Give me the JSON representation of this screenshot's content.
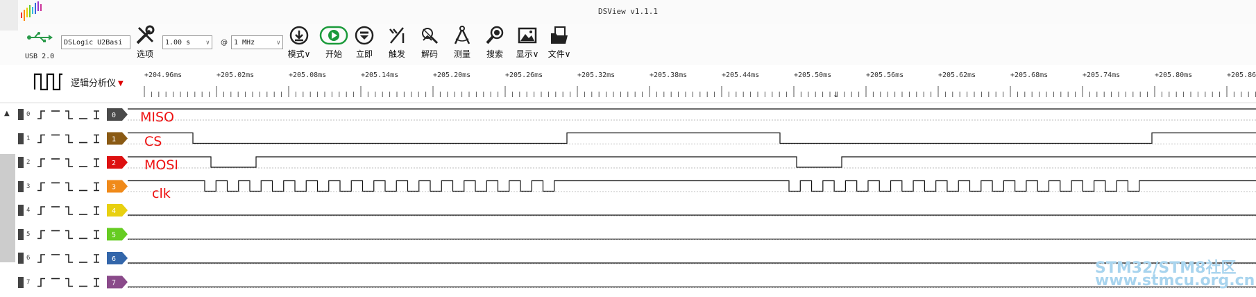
{
  "app": {
    "title": "DSView v1.1.1"
  },
  "device": {
    "usb_label": "USB 2.0",
    "name": "DSLogic U2Basi",
    "duration": "1.00 s",
    "at": "@",
    "rate": "1 MHz"
  },
  "toolbar": {
    "options": "选项",
    "mode": "模式",
    "start": "开始",
    "instant": "立即",
    "trigger": "触发",
    "decode": "解码",
    "measure": "测量",
    "search": "搜索",
    "display": "显示",
    "file": "文件"
  },
  "ruler": {
    "label": "逻辑分析仪",
    "ticks": [
      "+204.96ms",
      "+205.02ms",
      "+205.08ms",
      "+205.14ms",
      "+205.20ms",
      "+205.26ms",
      "+205.32ms",
      "+205.38ms",
      "+205.44ms",
      "+205.50ms",
      "+205.56ms",
      "+205.62ms",
      "+205.68ms",
      "+205.74ms",
      "+205.80ms",
      "+205.86"
    ]
  },
  "channels": [
    {
      "num": "0",
      "color": "#4a4a4a"
    },
    {
      "num": "1",
      "color": "#8a5a14"
    },
    {
      "num": "2",
      "color": "#dd1111"
    },
    {
      "num": "3",
      "color": "#f08a1a"
    },
    {
      "num": "4",
      "color": "#e8d010"
    },
    {
      "num": "5",
      "color": "#66cc22"
    },
    {
      "num": "6",
      "color": "#3366aa"
    },
    {
      "num": "7",
      "color": "#8a4a8a"
    }
  ],
  "annotations": {
    "miso": "MISO",
    "cs": "CS",
    "mosi": "MOSI",
    "clk": "clk"
  },
  "watermark": {
    "line1": "STM32/STM8社区",
    "line2": "www.stmcu.org.cn"
  }
}
